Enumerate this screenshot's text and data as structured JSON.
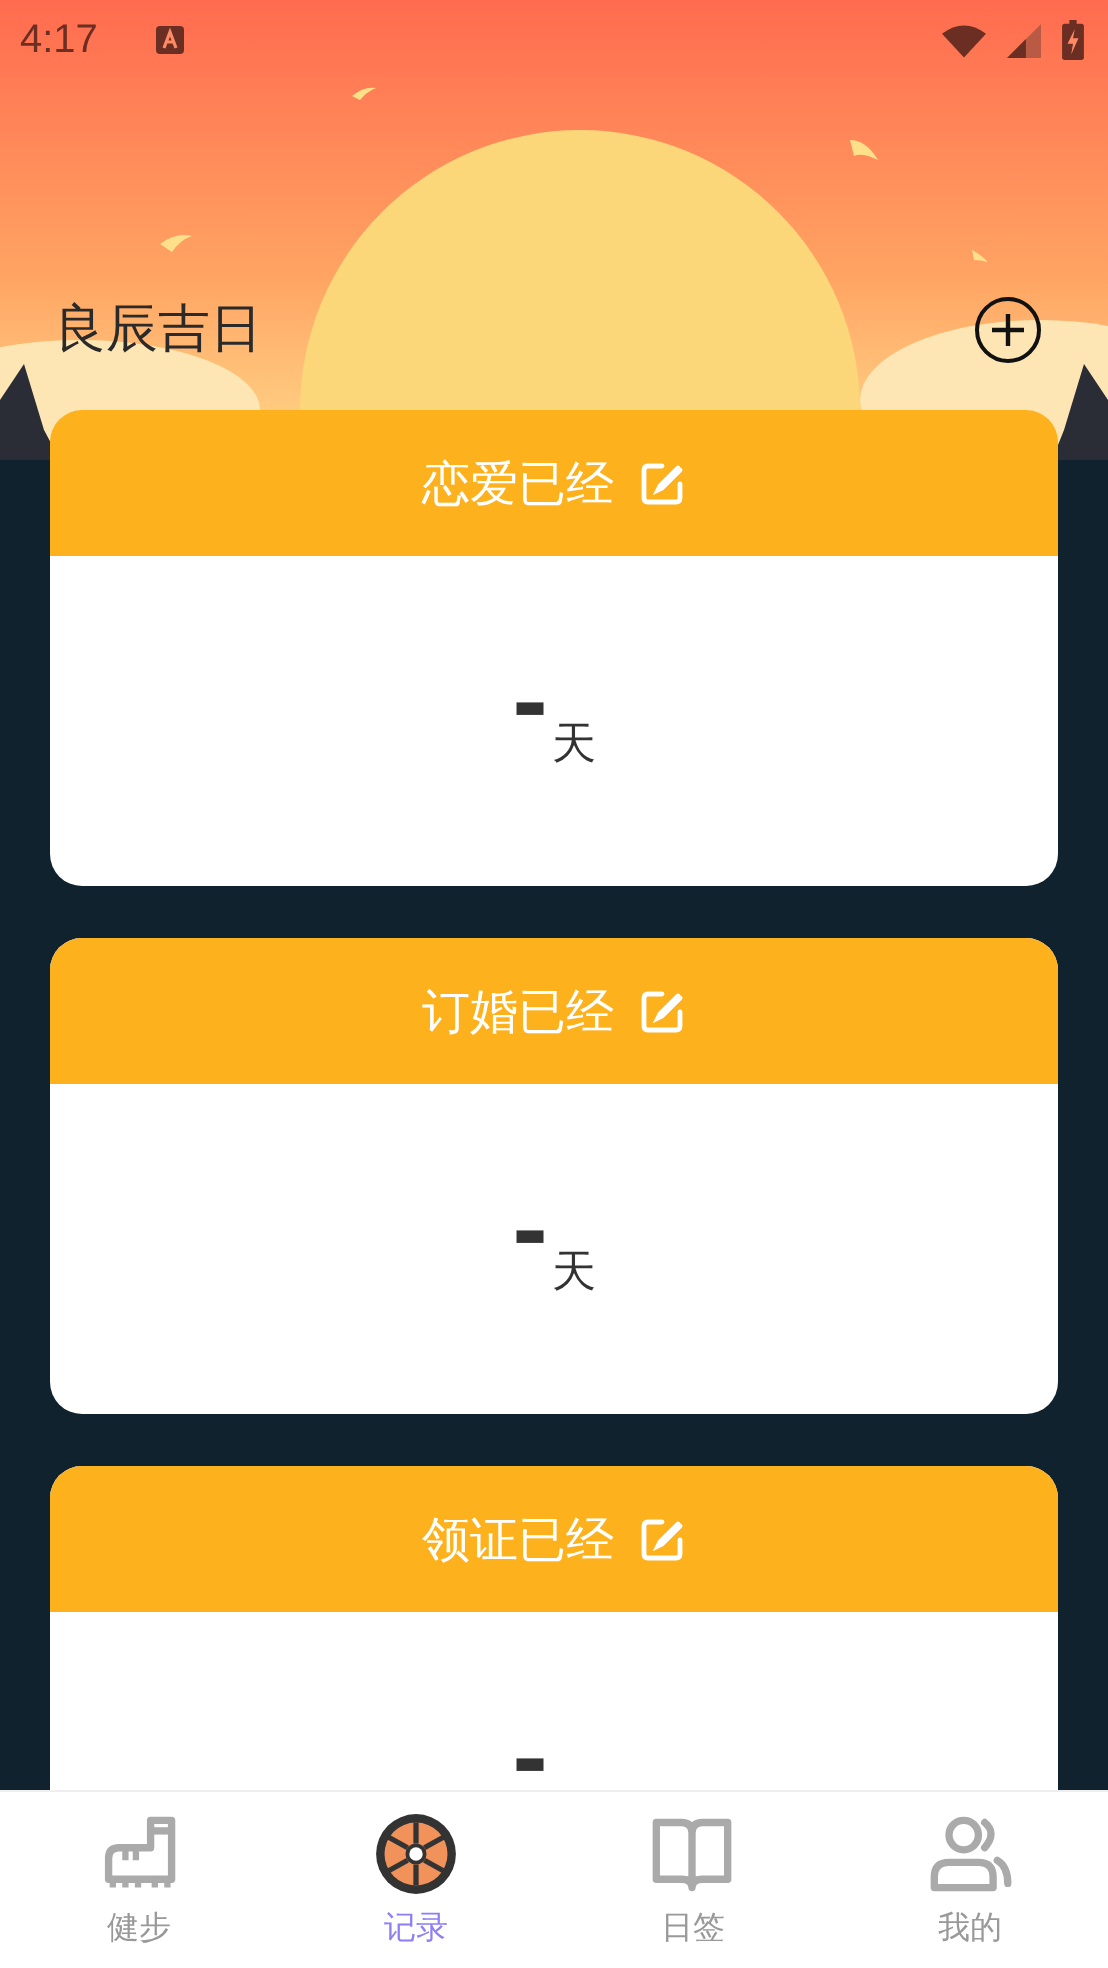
{
  "status_bar": {
    "time": "4:17"
  },
  "header": {
    "title": "良辰吉日"
  },
  "cards": [
    {
      "title": "恋爱已经",
      "value": "-",
      "unit": "天"
    },
    {
      "title": "订婚已经",
      "value": "-",
      "unit": "天"
    },
    {
      "title": "领证已经",
      "value": "-"
    }
  ],
  "nav": [
    {
      "label": "健步",
      "selected": false
    },
    {
      "label": "记录",
      "selected": true
    },
    {
      "label": "日签",
      "selected": false
    },
    {
      "label": "我的",
      "selected": false
    }
  ]
}
